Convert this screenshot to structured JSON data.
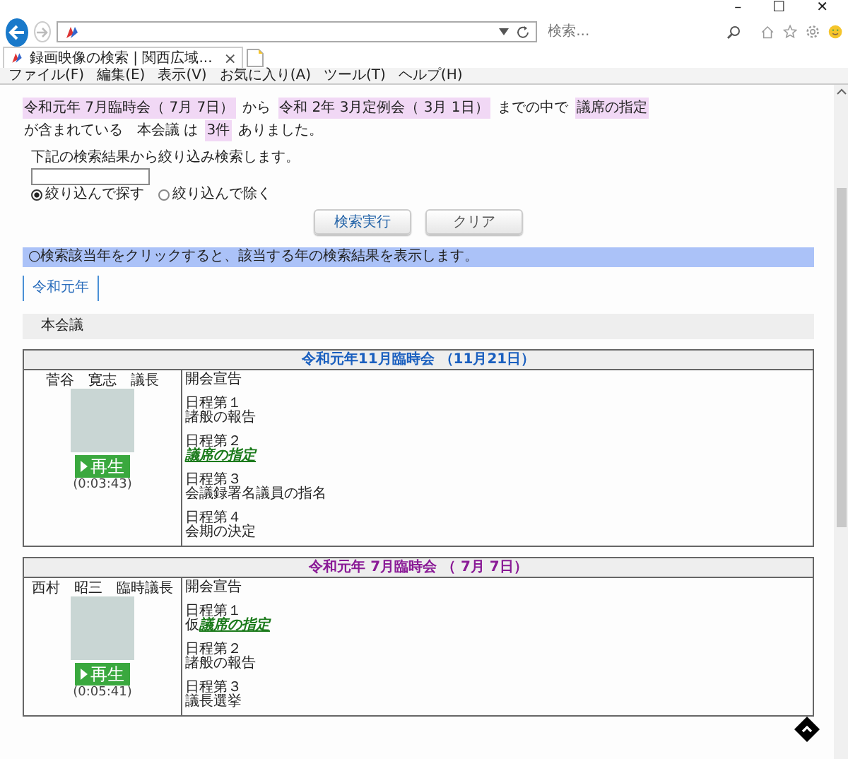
{
  "window": {
    "controls": [
      "–",
      "☐",
      "✕"
    ]
  },
  "browser": {
    "search_placeholder": "検索...",
    "tab_title": "録画映像の検索 | 関西広域...",
    "tab_close": "×"
  },
  "menu": [
    "ファイル(F)",
    "編集(E)",
    "表示(V)",
    "お気に入り(A)",
    "ツール(T)",
    "ヘルプ(H)"
  ],
  "summary": [
    {
      "text": "令和元年 7月臨時会（ 7月 7日）",
      "highlighted": true
    },
    {
      "text": "から",
      "highlighted": false
    },
    {
      "text": "令和 2年 3月定例会（ 3月 1日）",
      "highlighted": true
    },
    {
      "text": "までの中で",
      "highlighted": false
    },
    {
      "text": "議席の指定",
      "highlighted": true
    },
    {
      "text": "が含まれている　本会議 は",
      "highlighted": false
    },
    {
      "text": "3件",
      "highlighted": true
    },
    {
      "text": "ありました。",
      "highlighted": false
    }
  ],
  "filter": {
    "label": "下記の検索結果から絞り込み検索します。",
    "options": [
      {
        "label": "絞り込んで探す",
        "selected": true
      },
      {
        "label": "絞り込んで除く",
        "selected": false
      }
    ]
  },
  "buttons": [
    "検索実行",
    "クリア"
  ],
  "notice": "○検索該当年をクリックすると、該当する年の検索結果を表示します。",
  "year_tabs": [
    {
      "label": "令和元年",
      "selected": true
    }
  ],
  "section": "本会議",
  "sessions": [
    {
      "title": "令和元年11月臨時会 （11月21日）",
      "visited": false,
      "speaker": "菅谷　寛志　議長",
      "play": "再生",
      "duration": "(0:03:43)",
      "agenda": [
        {
          "title": "開会宣告",
          "kind": "plain"
        },
        {
          "number": "日程第１",
          "title": "諸般の報告",
          "kind": "plain"
        },
        {
          "number": "日程第２",
          "title": "議席の指定",
          "kind": "match"
        },
        {
          "number": "日程第３",
          "title": "会議録署名議員の指名",
          "kind": "plain"
        },
        {
          "number": "日程第４",
          "title": "会期の決定",
          "kind": "plain"
        }
      ]
    },
    {
      "title": "令和元年 7月臨時会 （ 7月 7日）",
      "visited": true,
      "speaker": "西村　昭三　臨時議長",
      "play": "再生",
      "duration": "(0:05:41)",
      "agenda": [
        {
          "title": "開会宣告",
          "kind": "plain"
        },
        {
          "number": "日程第１",
          "prefix": "仮",
          "title": "議席の指定",
          "kind": "match"
        },
        {
          "number": "日程第２",
          "title": "諸般の報告",
          "kind": "plain"
        },
        {
          "number": "日程第３",
          "title": "議長選挙",
          "kind": "plain"
        }
      ]
    }
  ]
}
